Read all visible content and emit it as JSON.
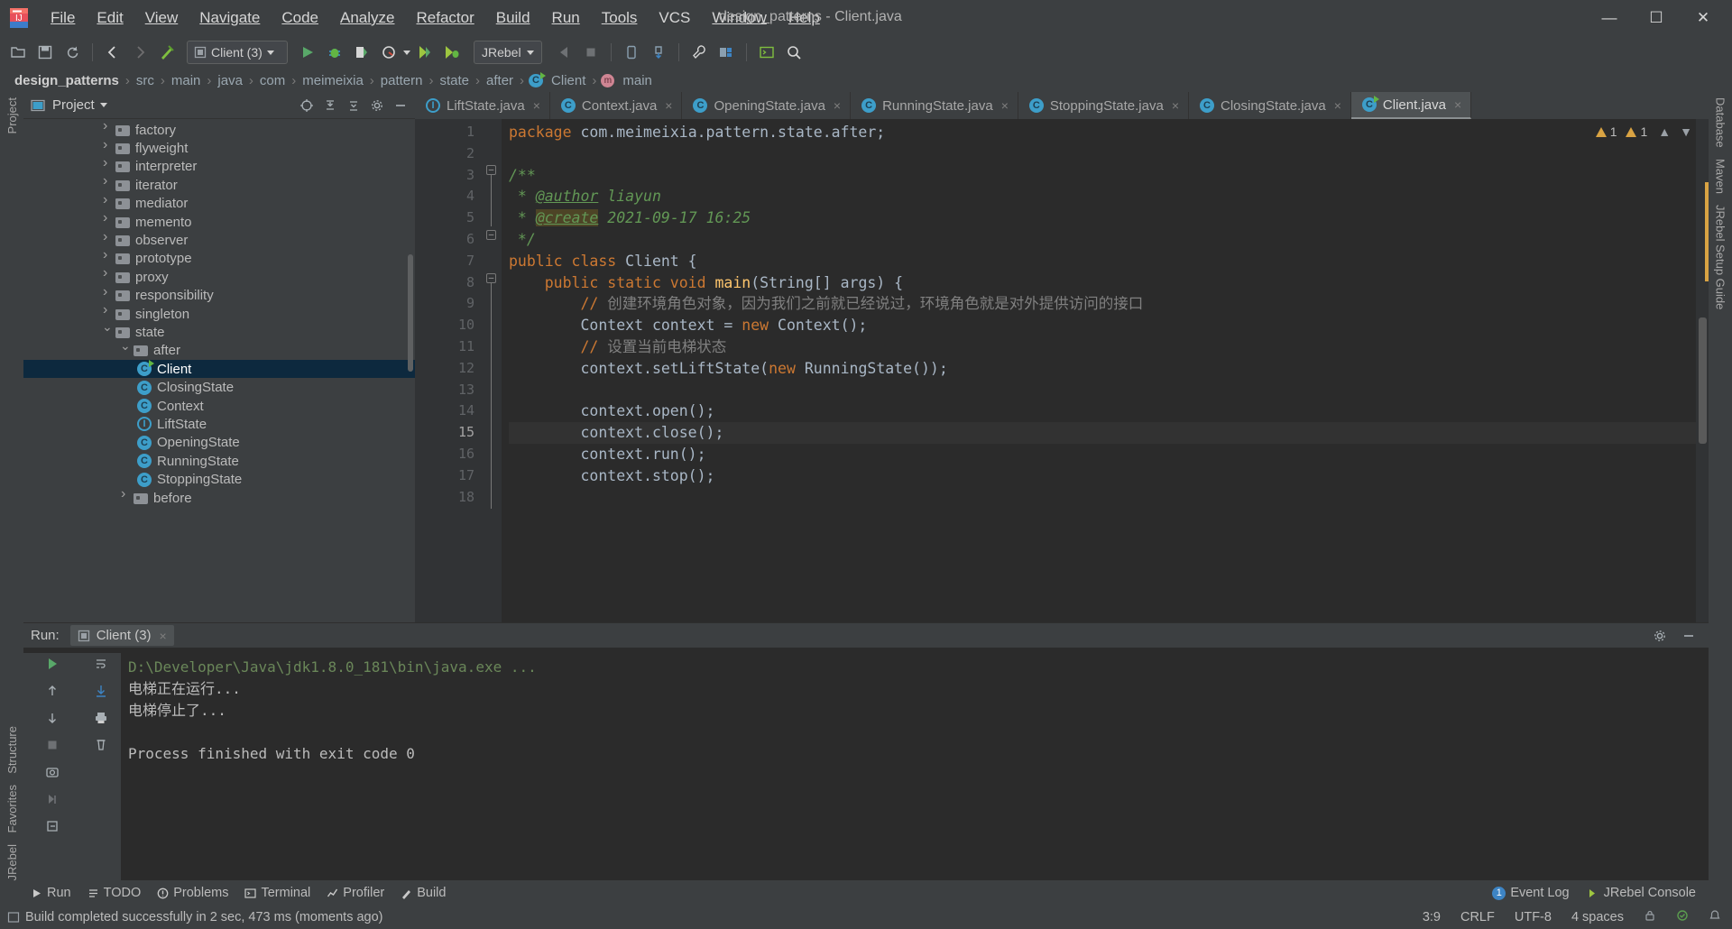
{
  "window": {
    "title": "design_patterns - Client.java",
    "controls": [
      "minimize",
      "maximize",
      "close"
    ]
  },
  "menu": {
    "items": [
      "File",
      "Edit",
      "View",
      "Navigate",
      "Code",
      "Analyze",
      "Refactor",
      "Build",
      "Run",
      "Tools",
      "VCS",
      "Window",
      "Help"
    ]
  },
  "toolbar": {
    "run_config": "Client (3)",
    "jrebel_label": "JRebel",
    "icons": [
      "open-folder-icon",
      "save-icon",
      "sync-icon",
      "back-arrow-icon",
      "forward-arrow-icon",
      "build-hammer-icon",
      "run-icon",
      "debug-icon",
      "run-coverage-icon",
      "profile-icon",
      "jrebel-run-icon",
      "jrebel-debug-icon",
      "update-app-icon",
      "stop-icon",
      "android-device-icon",
      "sdk-icon",
      "settings-wrench-icon",
      "project-structure-icon",
      "terminal-icon",
      "search-everywhere-icon"
    ]
  },
  "breadcrumb": {
    "items": [
      "design_patterns",
      "src",
      "main",
      "java",
      "com",
      "meimeixia",
      "pattern",
      "state",
      "after",
      "Client",
      "main"
    ],
    "separator": "›"
  },
  "project_panel": {
    "title": "Project",
    "header_icons": [
      "locate-icon",
      "expand-all-icon",
      "collapse-all-icon",
      "gear-icon",
      "hide-icon"
    ],
    "tree": [
      {
        "label": "factory",
        "depth": 4,
        "type": "folder",
        "state": "collapsed"
      },
      {
        "label": "flyweight",
        "depth": 4,
        "type": "folder",
        "state": "collapsed"
      },
      {
        "label": "interpreter",
        "depth": 4,
        "type": "folder",
        "state": "collapsed"
      },
      {
        "label": "iterator",
        "depth": 4,
        "type": "folder",
        "state": "collapsed"
      },
      {
        "label": "mediator",
        "depth": 4,
        "type": "folder",
        "state": "collapsed"
      },
      {
        "label": "memento",
        "depth": 4,
        "type": "folder",
        "state": "collapsed"
      },
      {
        "label": "observer",
        "depth": 4,
        "type": "folder",
        "state": "collapsed"
      },
      {
        "label": "prototype",
        "depth": 4,
        "type": "folder",
        "state": "collapsed"
      },
      {
        "label": "proxy",
        "depth": 4,
        "type": "folder",
        "state": "collapsed"
      },
      {
        "label": "responsibility",
        "depth": 4,
        "type": "folder",
        "state": "collapsed"
      },
      {
        "label": "singleton",
        "depth": 4,
        "type": "folder",
        "state": "collapsed"
      },
      {
        "label": "state",
        "depth": 4,
        "type": "folder",
        "state": "expanded"
      },
      {
        "label": "after",
        "depth": 5,
        "type": "folder",
        "state": "expanded"
      },
      {
        "label": "Client",
        "depth": 6,
        "type": "class-runnable",
        "selected": true
      },
      {
        "label": "ClosingState",
        "depth": 6,
        "type": "class"
      },
      {
        "label": "Context",
        "depth": 6,
        "type": "class"
      },
      {
        "label": "LiftState",
        "depth": 6,
        "type": "interface"
      },
      {
        "label": "OpeningState",
        "depth": 6,
        "type": "class"
      },
      {
        "label": "RunningState",
        "depth": 6,
        "type": "class"
      },
      {
        "label": "StoppingState",
        "depth": 6,
        "type": "class"
      },
      {
        "label": "before",
        "depth": 5,
        "type": "folder",
        "state": "collapsed"
      }
    ]
  },
  "editor": {
    "tabs": [
      {
        "label": "LiftState.java",
        "icon": "interface-icon",
        "active": false
      },
      {
        "label": "Context.java",
        "icon": "class-icon",
        "active": false
      },
      {
        "label": "OpeningState.java",
        "icon": "class-icon",
        "active": false
      },
      {
        "label": "RunningState.java",
        "icon": "class-icon",
        "active": false
      },
      {
        "label": "StoppingState.java",
        "icon": "class-icon",
        "active": false
      },
      {
        "label": "ClosingState.java",
        "icon": "class-icon",
        "active": false
      },
      {
        "label": "Client.java",
        "icon": "class-runnable-icon",
        "active": true
      }
    ],
    "close_glyph": "×",
    "inspection": {
      "warnings": "1",
      "weak_warnings": "1"
    },
    "current_line": 15,
    "line_numbers": [
      "1",
      "2",
      "3",
      "4",
      "5",
      "6",
      "7",
      "8",
      "9",
      "10",
      "11",
      "12",
      "13",
      "14",
      "15",
      "16",
      "17",
      "18"
    ],
    "code_lines": [
      {
        "n": 1,
        "segments": [
          {
            "t": "package ",
            "c": "kw"
          },
          {
            "t": "com.meimeixia.pattern.state.after;",
            "c": "pl"
          }
        ]
      },
      {
        "n": 2,
        "segments": []
      },
      {
        "n": 3,
        "segments": [
          {
            "t": "/**",
            "c": "doc"
          }
        ]
      },
      {
        "n": 4,
        "segments": [
          {
            "t": " * ",
            "c": "doc"
          },
          {
            "t": "@author",
            "c": "tag"
          },
          {
            "t": " liayun",
            "c": "doc"
          }
        ]
      },
      {
        "n": 5,
        "segments": [
          {
            "t": " * ",
            "c": "doc"
          },
          {
            "t": "@create",
            "c": "tag hl"
          },
          {
            "t": " 2021-09-17 16:25",
            "c": "doc"
          }
        ]
      },
      {
        "n": 6,
        "segments": [
          {
            "t": " */",
            "c": "doc"
          }
        ]
      },
      {
        "n": 7,
        "segments": [
          {
            "t": "public class ",
            "c": "kw"
          },
          {
            "t": "Client {",
            "c": "pl"
          }
        ]
      },
      {
        "n": 8,
        "segments": [
          {
            "t": "    public static void ",
            "c": "kw"
          },
          {
            "t": "main",
            "c": "mth"
          },
          {
            "t": "(String[] args) {",
            "c": "pl"
          }
        ]
      },
      {
        "n": 9,
        "segments": [
          {
            "t": "        // ",
            "c": "cmt-slash"
          },
          {
            "t": "创建环境角色对象，因为我们之前就已经说过，环境角色就是对外提供访问的接口",
            "c": "cmt-zh"
          }
        ]
      },
      {
        "n": 10,
        "segments": [
          {
            "t": "        Context context = ",
            "c": "pl"
          },
          {
            "t": "new ",
            "c": "kw"
          },
          {
            "t": "Context();",
            "c": "pl"
          }
        ]
      },
      {
        "n": 11,
        "segments": [
          {
            "t": "        // ",
            "c": "cmt-slash"
          },
          {
            "t": "设置当前电梯状态",
            "c": "cmt-zh"
          }
        ]
      },
      {
        "n": 12,
        "segments": [
          {
            "t": "        context.setLiftState(",
            "c": "pl"
          },
          {
            "t": "new ",
            "c": "kw"
          },
          {
            "t": "RunningState());",
            "c": "pl"
          }
        ]
      },
      {
        "n": 13,
        "segments": []
      },
      {
        "n": 14,
        "segments": [
          {
            "t": "        context.open();",
            "c": "pl"
          }
        ]
      },
      {
        "n": 15,
        "segments": [
          {
            "t": "        context.close();",
            "c": "pl"
          }
        ]
      },
      {
        "n": 16,
        "segments": [
          {
            "t": "        context.run();",
            "c": "pl"
          }
        ]
      },
      {
        "n": 17,
        "segments": [
          {
            "t": "        context.stop();",
            "c": "pl"
          }
        ]
      },
      {
        "n": 18,
        "segments": []
      }
    ]
  },
  "run_panel": {
    "label": "Run:",
    "tab_label": "Client (3)",
    "close_glyph": "×",
    "gear_icon": "gear-icon",
    "minimize_icon": "minimize-icon",
    "side_icons": [
      "rerun-icon",
      "up-arrow-icon",
      "down-arrow-icon",
      "stop-icon",
      "soft-wrap-icon",
      "scroll-to-end-icon",
      "print-icon",
      "clear-all-icon"
    ],
    "console": [
      {
        "text": "D:\\Developer\\Java\\jdk1.8.0_181\\bin\\java.exe ...",
        "color": "#6a8759"
      },
      {
        "text": "电梯正在运行...",
        "color": "#bbbbbb"
      },
      {
        "text": "电梯停止了...",
        "color": "#bbbbbb"
      },
      {
        "text": "",
        "color": "#bbbbbb"
      },
      {
        "text": "Process finished with exit code 0",
        "color": "#bbbbbb"
      }
    ]
  },
  "tool_windows": {
    "left": [
      "Project",
      "Structure",
      "Favorites",
      "JRebel"
    ],
    "right": [
      "Database",
      "Maven",
      "JRebel Setup Guide"
    ]
  },
  "bottom_bar": {
    "items": [
      {
        "label": "Run",
        "icon": "run-icon"
      },
      {
        "label": "TODO",
        "icon": "todo-icon"
      },
      {
        "label": "Problems",
        "icon": "problems-icon"
      },
      {
        "label": "Terminal",
        "icon": "terminal-icon"
      },
      {
        "label": "Profiler",
        "icon": "profiler-icon"
      },
      {
        "label": "Build",
        "icon": "build-icon"
      }
    ],
    "right": [
      {
        "label": "Event Log",
        "badge": "1",
        "icon": "event-log-icon"
      },
      {
        "label": "JRebel Console",
        "icon": "jrebel-icon"
      }
    ]
  },
  "status_bar": {
    "message": "Build completed successfully in 2 sec, 473 ms (moments ago)",
    "caret": "3:9",
    "line_sep": "CRLF",
    "encoding": "UTF-8",
    "indent": "4 spaces",
    "icons": [
      "lock-icon",
      "inspection-icon",
      "notifications-icon"
    ]
  },
  "colors": {
    "bg_chrome": "#3c3f41",
    "bg_editor": "#2b2b2b",
    "gutter": "#313335",
    "selection": "#0d293e",
    "accent_blue": "#3d9ec9",
    "keyword_orange": "#cc7832",
    "string_green": "#6a8759",
    "doc_green": "#629755",
    "method_yellow": "#ffc66d",
    "text": "#bbbbbb"
  }
}
